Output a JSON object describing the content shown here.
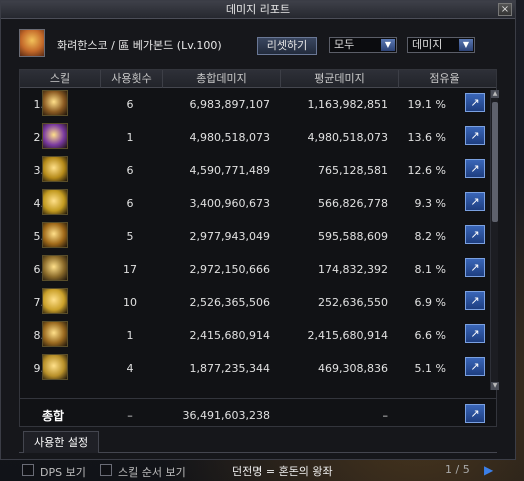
{
  "window": {
    "title": "데미지 리포트",
    "close": "×"
  },
  "header": {
    "character": "화려한스코 / 區 베가본드 (Lv.100)",
    "reset_label": "리셋하기",
    "filter1": "모두",
    "filter2": "데미지"
  },
  "columns": [
    "스킬",
    "사용횟수",
    "총합데미지",
    "평균데미지",
    "점유율"
  ],
  "rows": [
    {
      "rank": "1.",
      "uses": "6",
      "total": "6,983,897,107",
      "avg": "1,163,982,851",
      "pct": "19.1 %",
      "icon_color": "#8a5a22"
    },
    {
      "rank": "2.",
      "uses": "1",
      "total": "4,980,518,073",
      "avg": "4,980,518,073",
      "pct": "13.6 %",
      "icon_color": "#7a3aa0"
    },
    {
      "rank": "3.",
      "uses": "6",
      "total": "4,590,771,489",
      "avg": "765,128,581",
      "pct": "12.6 %",
      "icon_color": "#b58a1a"
    },
    {
      "rank": "4.",
      "uses": "6",
      "total": "3,400,960,673",
      "avg": "566,826,778",
      "pct": "9.3 %",
      "icon_color": "#c29a20"
    },
    {
      "rank": "5.",
      "uses": "5",
      "total": "2,977,943,049",
      "avg": "595,588,609",
      "pct": "8.2 %",
      "icon_color": "#a06a1a"
    },
    {
      "rank": "6.",
      "uses": "17",
      "total": "2,972,150,666",
      "avg": "174,832,392",
      "pct": "8.1 %",
      "icon_color": "#8a6a2a"
    },
    {
      "rank": "7.",
      "uses": "10",
      "total": "2,526,365,506",
      "avg": "252,636,550",
      "pct": "6.9 %",
      "icon_color": "#caa02a"
    },
    {
      "rank": "8.",
      "uses": "1",
      "total": "2,415,680,914",
      "avg": "2,415,680,914",
      "pct": "6.6 %",
      "icon_color": "#9a6a20"
    },
    {
      "rank": "9.",
      "uses": "4",
      "total": "1,877,235,344",
      "avg": "469,308,836",
      "pct": "5.1 %",
      "icon_color": "#b8902a"
    }
  ],
  "total": {
    "label": "총합",
    "uses": "–",
    "total": "36,491,603,238",
    "avg": "–"
  },
  "tab": "사용한 설정",
  "footer": {
    "dps_label": "DPS 보기",
    "order_label": "스킬 순서 보기",
    "dungeon": "던전명 = 혼돈의 왕좌",
    "page": "1 / 5",
    "next": "▶"
  },
  "share_icon": "share-icon"
}
